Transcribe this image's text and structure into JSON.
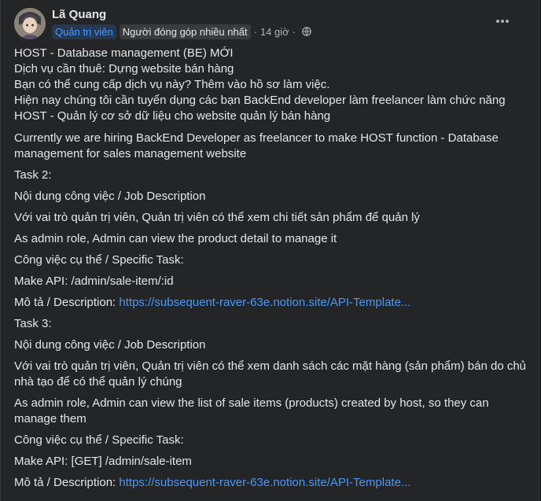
{
  "post": {
    "author": "Lã Quang",
    "badges": {
      "admin": "Quản trị viên",
      "contributor": "Người đóng góp nhiều nhất"
    },
    "separator": "·",
    "time": "14 giờ",
    "privacy_icon": "globe-icon",
    "more_icon": "more-horizontal-icon"
  },
  "body": {
    "head_lines": [
      "HOST - Database management (BE) MỚI",
      "Dịch vụ cần thuê: Dựng website bán hàng",
      "Bạn có thể cung cấp dịch vụ này? Thêm vào hồ sơ làm việc.",
      "Hiện nay chúng tôi cần tuyển dụng các bạn BackEnd developer làm freelancer làm chức năng",
      "HOST - Quản lý cơ sở dữ liệu cho website quản lý bán hàng"
    ],
    "intro_en": "Currently we are hiring BackEnd Developer as freelancer to make HOST function - Database management for sales management website",
    "task2": {
      "title": "Task 2:",
      "job_heading": "Nội dung công việc / Job Description",
      "desc_vi": "Với vai trò quản trị viên, Quản trị viên có thể xem chi tiết sản phẩm để quản lý",
      "desc_en": "As admin role, Admin can view the product detail to manage it",
      "specific_heading": "Công việc cụ thể / Specific Task:",
      "api": "Make API: /admin/sale-item/:id",
      "desc_label": "Mô tả / Description: ",
      "link": "https://subsequent-raver-63e.notion.site/API-Template..."
    },
    "task3": {
      "title": "Task 3:",
      "job_heading": "Nội dung công việc / Job Description",
      "desc_vi": "Với vai trò quản trị viên, Quản trị viên có thể xem danh sách các mặt hàng (sản phẩm) bán do chủ nhà tạo để có thể quản lý chúng",
      "desc_en": "As admin role, Admin can view the list of sale items (products) created by host, so they can manage them",
      "specific_heading": "Công việc cụ thể / Specific Task:",
      "api": "Make API: [GET] /admin/sale-item",
      "desc_label": "Mô tả / Description: ",
      "link": "https://subsequent-raver-63e.notion.site/API-Template..."
    }
  }
}
